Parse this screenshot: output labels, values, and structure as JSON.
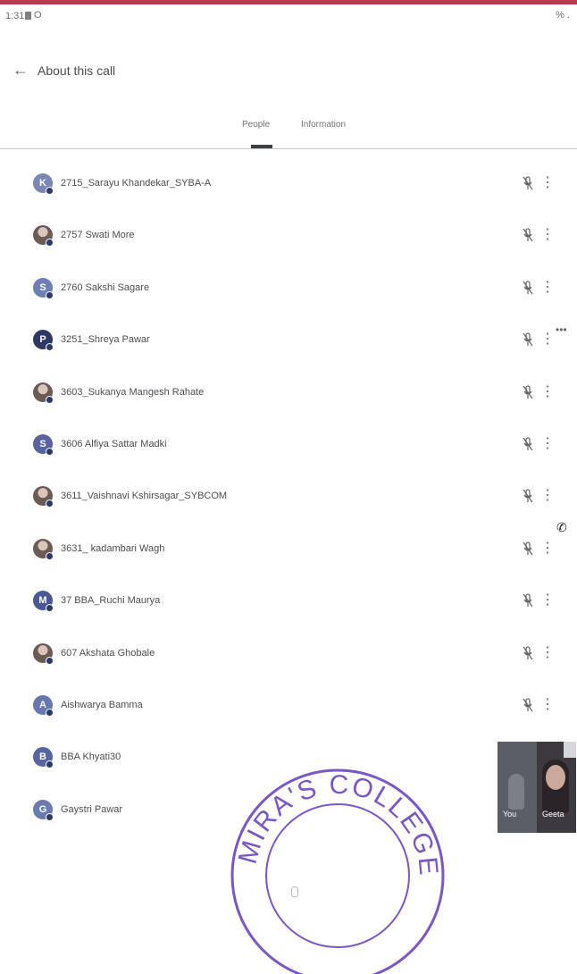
{
  "status_bar": {
    "time": "1:31",
    "indicator": "O",
    "right": "% ."
  },
  "header": {
    "title": "About this call"
  },
  "tabs": [
    {
      "label": "People",
      "active": true
    },
    {
      "label": "Information",
      "active": false
    }
  ],
  "participants": [
    {
      "name": "2715_Sarayu Khandekar_SYBA-A",
      "initial": "K",
      "color": "#7b86b6",
      "photo": false
    },
    {
      "name": "2757 Swati More",
      "initial": "",
      "color": "#8aa0c8",
      "photo": true
    },
    {
      "name": "2760 Sakshi Sagare",
      "initial": "S",
      "color": "#6d7fb3",
      "photo": false
    },
    {
      "name": "3251_Shreya Pawar",
      "initial": "P",
      "color": "#2f3767",
      "photo": false
    },
    {
      "name": "3603_Sukanya Mangesh Rahate",
      "initial": "",
      "color": "#7a5a62",
      "photo": true
    },
    {
      "name": "3606 Alfiya Sattar Madki",
      "initial": "S",
      "color": "#5a63a0",
      "photo": false
    },
    {
      "name": "3611_Vaishnavi Kshirsagar_SYBCOM",
      "initial": "",
      "color": "#7a4a5a",
      "photo": true
    },
    {
      "name": "3631_ kadambari Wagh",
      "initial": "",
      "color": "#9a8fae",
      "photo": true
    },
    {
      "name": "37 BBA_Ruchi Maurya",
      "initial": "M",
      "color": "#4b5897",
      "photo": false
    },
    {
      "name": "607 Akshata Ghobale",
      "initial": "",
      "color": "#4a3a56",
      "photo": true
    },
    {
      "name": "Aishwarya Bamma",
      "initial": "A",
      "color": "#6878ae",
      "photo": false
    },
    {
      "name": "BBA Khyati30",
      "initial": "B",
      "color": "#5665a4",
      "photo": false
    },
    {
      "name": "Gaystri Pawar",
      "initial": "G",
      "color": "#6b7ab0",
      "photo": false
    }
  ],
  "video_tiles": {
    "self_label": "You",
    "other_label": "Geeta"
  },
  "stamp": {
    "text": "MIRA'S COLLEGE FOR GIRLS",
    "color": "#7a56c8"
  }
}
